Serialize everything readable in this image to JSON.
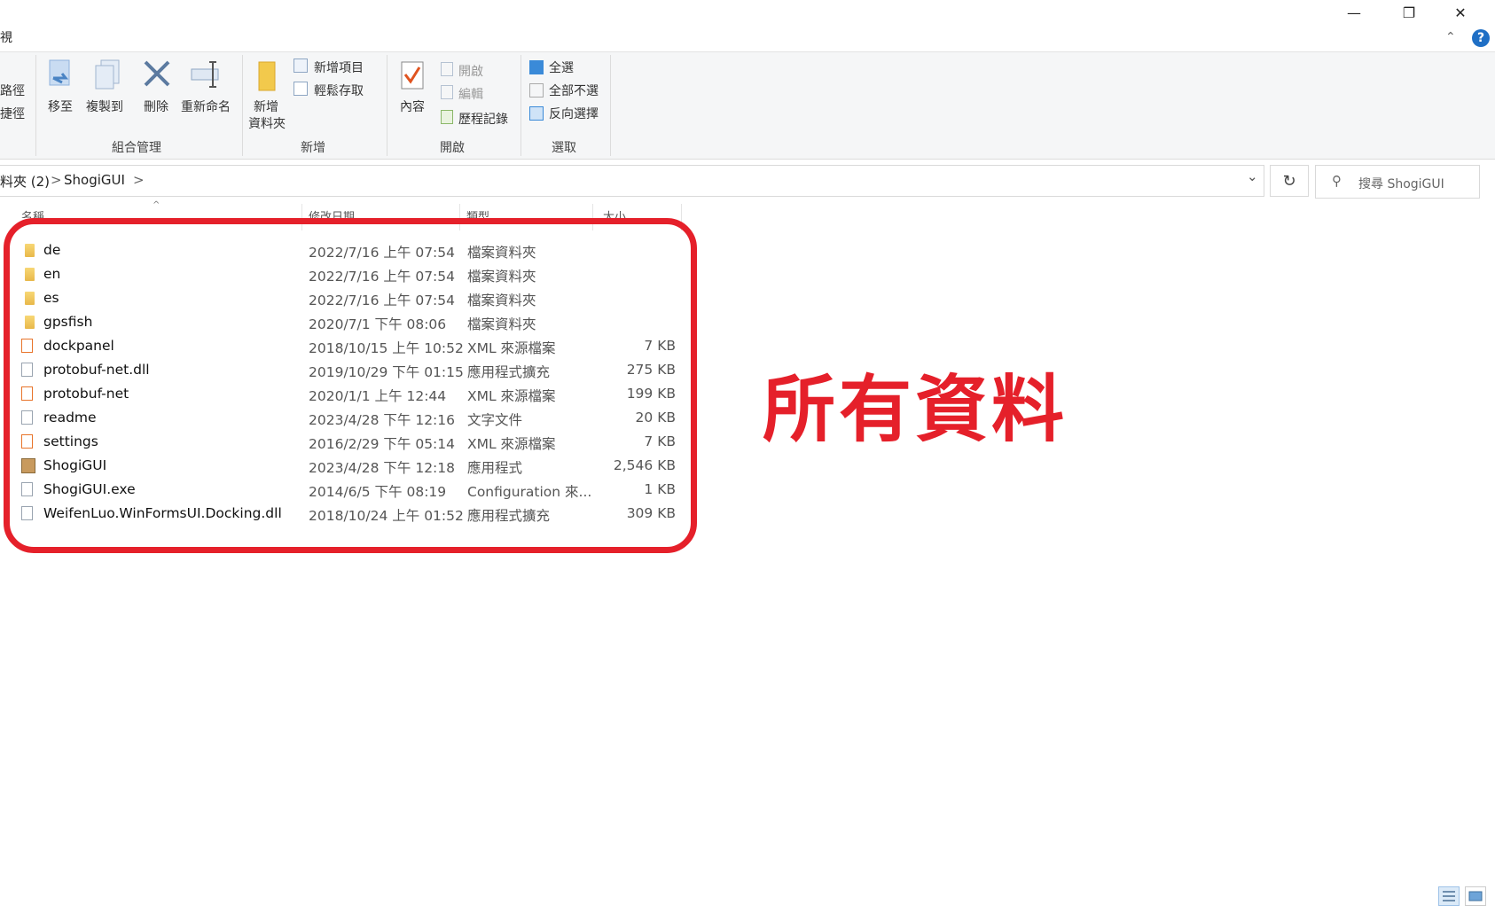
{
  "window": {
    "minimize": "—",
    "restore": "❐",
    "close": "✕"
  },
  "menu": {
    "view_tab_fragment": "視",
    "collapse": "⌃",
    "help": "?"
  },
  "ribbon": {
    "left_fragment": [
      "路徑",
      "捷徑"
    ],
    "organize": {
      "move_to": "移至",
      "copy_to": "複製到",
      "delete": "刪除",
      "rename": "重新命名",
      "group": "組合管理"
    },
    "new": {
      "new_folder_line1": "新增",
      "new_folder_line2": "資料夾",
      "new_item": "新增項目",
      "easy_access": "輕鬆存取",
      "group": "新增"
    },
    "open": {
      "properties": "內容",
      "open": "開啟",
      "edit": "編輯",
      "history": "歷程記錄",
      "group": "開啟"
    },
    "select": {
      "select_all": "全選",
      "select_none": "全部不選",
      "invert": "反向選擇",
      "group": "選取"
    }
  },
  "address": {
    "parent_fragment": "料夾 (2)",
    "sep": ">",
    "current": "ShogiGUI",
    "dropdown": "⌄",
    "refresh": "↻"
  },
  "search": {
    "placeholder": "搜尋 ShogiGUI"
  },
  "columns": {
    "name": "名稱",
    "date": "修改日期",
    "type": "類型",
    "size": "大小"
  },
  "files": [
    {
      "name": "de",
      "date": "2022/7/16 上午 07:54",
      "type": "檔案資料夾",
      "size": "",
      "icon": "folder-icon"
    },
    {
      "name": "en",
      "date": "2022/7/16 上午 07:54",
      "type": "檔案資料夾",
      "size": "",
      "icon": "folder-icon"
    },
    {
      "name": "es",
      "date": "2022/7/16 上午 07:54",
      "type": "檔案資料夾",
      "size": "",
      "icon": "folder-icon"
    },
    {
      "name": "gpsfish",
      "date": "2020/7/1 下午 08:06",
      "type": "檔案資料夾",
      "size": "",
      "icon": "folder-icon"
    },
    {
      "name": "dockpanel",
      "date": "2018/10/15 上午 10:52",
      "type": "XML 來源檔案",
      "size": "7 KB",
      "icon": "xml-file-icon"
    },
    {
      "name": "protobuf-net.dll",
      "date": "2019/10/29 下午 01:15",
      "type": "應用程式擴充",
      "size": "275 KB",
      "icon": "dll-file-icon"
    },
    {
      "name": "protobuf-net",
      "date": "2020/1/1 上午 12:44",
      "type": "XML 來源檔案",
      "size": "199 KB",
      "icon": "xml-file-icon"
    },
    {
      "name": "readme",
      "date": "2023/4/28 下午 12:16",
      "type": "文字文件",
      "size": "20 KB",
      "icon": "text-file-icon"
    },
    {
      "name": "settings",
      "date": "2016/2/29 下午 05:14",
      "type": "XML 來源檔案",
      "size": "7 KB",
      "icon": "xml-file-icon"
    },
    {
      "name": "ShogiGUI",
      "date": "2023/4/28 下午 12:18",
      "type": "應用程式",
      "size": "2,546 KB",
      "icon": "app-icon"
    },
    {
      "name": "ShogiGUI.exe",
      "date": "2014/6/5 下午 08:19",
      "type": "Configuration 來...",
      "size": "1 KB",
      "icon": "config-file-icon"
    },
    {
      "name": "WeifenLuo.WinFormsUI.Docking.dll",
      "date": "2018/10/24 上午 01:52",
      "type": "應用程式擴充",
      "size": "309 KB",
      "icon": "dll-file-icon"
    }
  ],
  "annotation": {
    "text": "所有資料",
    "color": "#e5202a"
  },
  "colors": {
    "folder": "#f0c55a",
    "xml": "#e8742a",
    "accent": "#1f6fc5"
  }
}
